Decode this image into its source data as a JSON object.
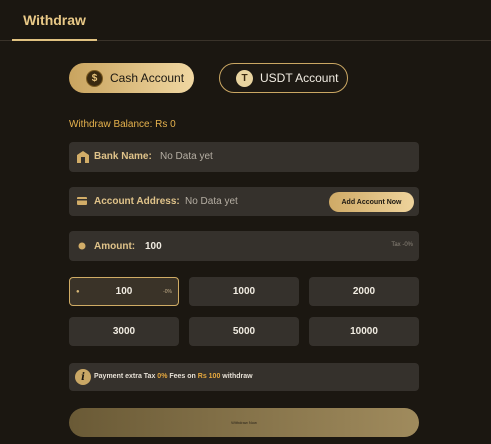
{
  "header": {
    "tab_label": "Withdraw"
  },
  "accounts": {
    "cash": {
      "label": "Cash Account",
      "icon": "dollar-coin-icon"
    },
    "usdt": {
      "label": "USDT Account",
      "icon": "tether-icon"
    }
  },
  "balance": {
    "text": "Withdraw Balance: Rs 0"
  },
  "bank": {
    "label": "Bank Name:",
    "value": "No Data yet",
    "icon": "bank-icon"
  },
  "address": {
    "label": "Account Address:",
    "value": "No Data yet",
    "add_button": "Add Account Now",
    "icon": "card-icon"
  },
  "amount": {
    "label": "Amount:",
    "value": "100",
    "tax": "Tax -0%",
    "icon": "coin-icon"
  },
  "amounts": [
    {
      "value": "100",
      "pct": "-0%"
    },
    {
      "value": "1000"
    },
    {
      "value": "2000"
    },
    {
      "value": "3000"
    },
    {
      "value": "5000"
    },
    {
      "value": "10000"
    }
  ],
  "note": {
    "prefix": "Payment extra Tax ",
    "pct": "0%",
    "mid": " Fees on ",
    "amount": "Rs 100",
    "suffix": " withdraw"
  },
  "submit": {
    "label": "Withdraw Now"
  },
  "colors": {
    "accent": "#e0c281",
    "background": "#1b1711",
    "card": "#35312c",
    "highlight": "#e6a83e"
  }
}
